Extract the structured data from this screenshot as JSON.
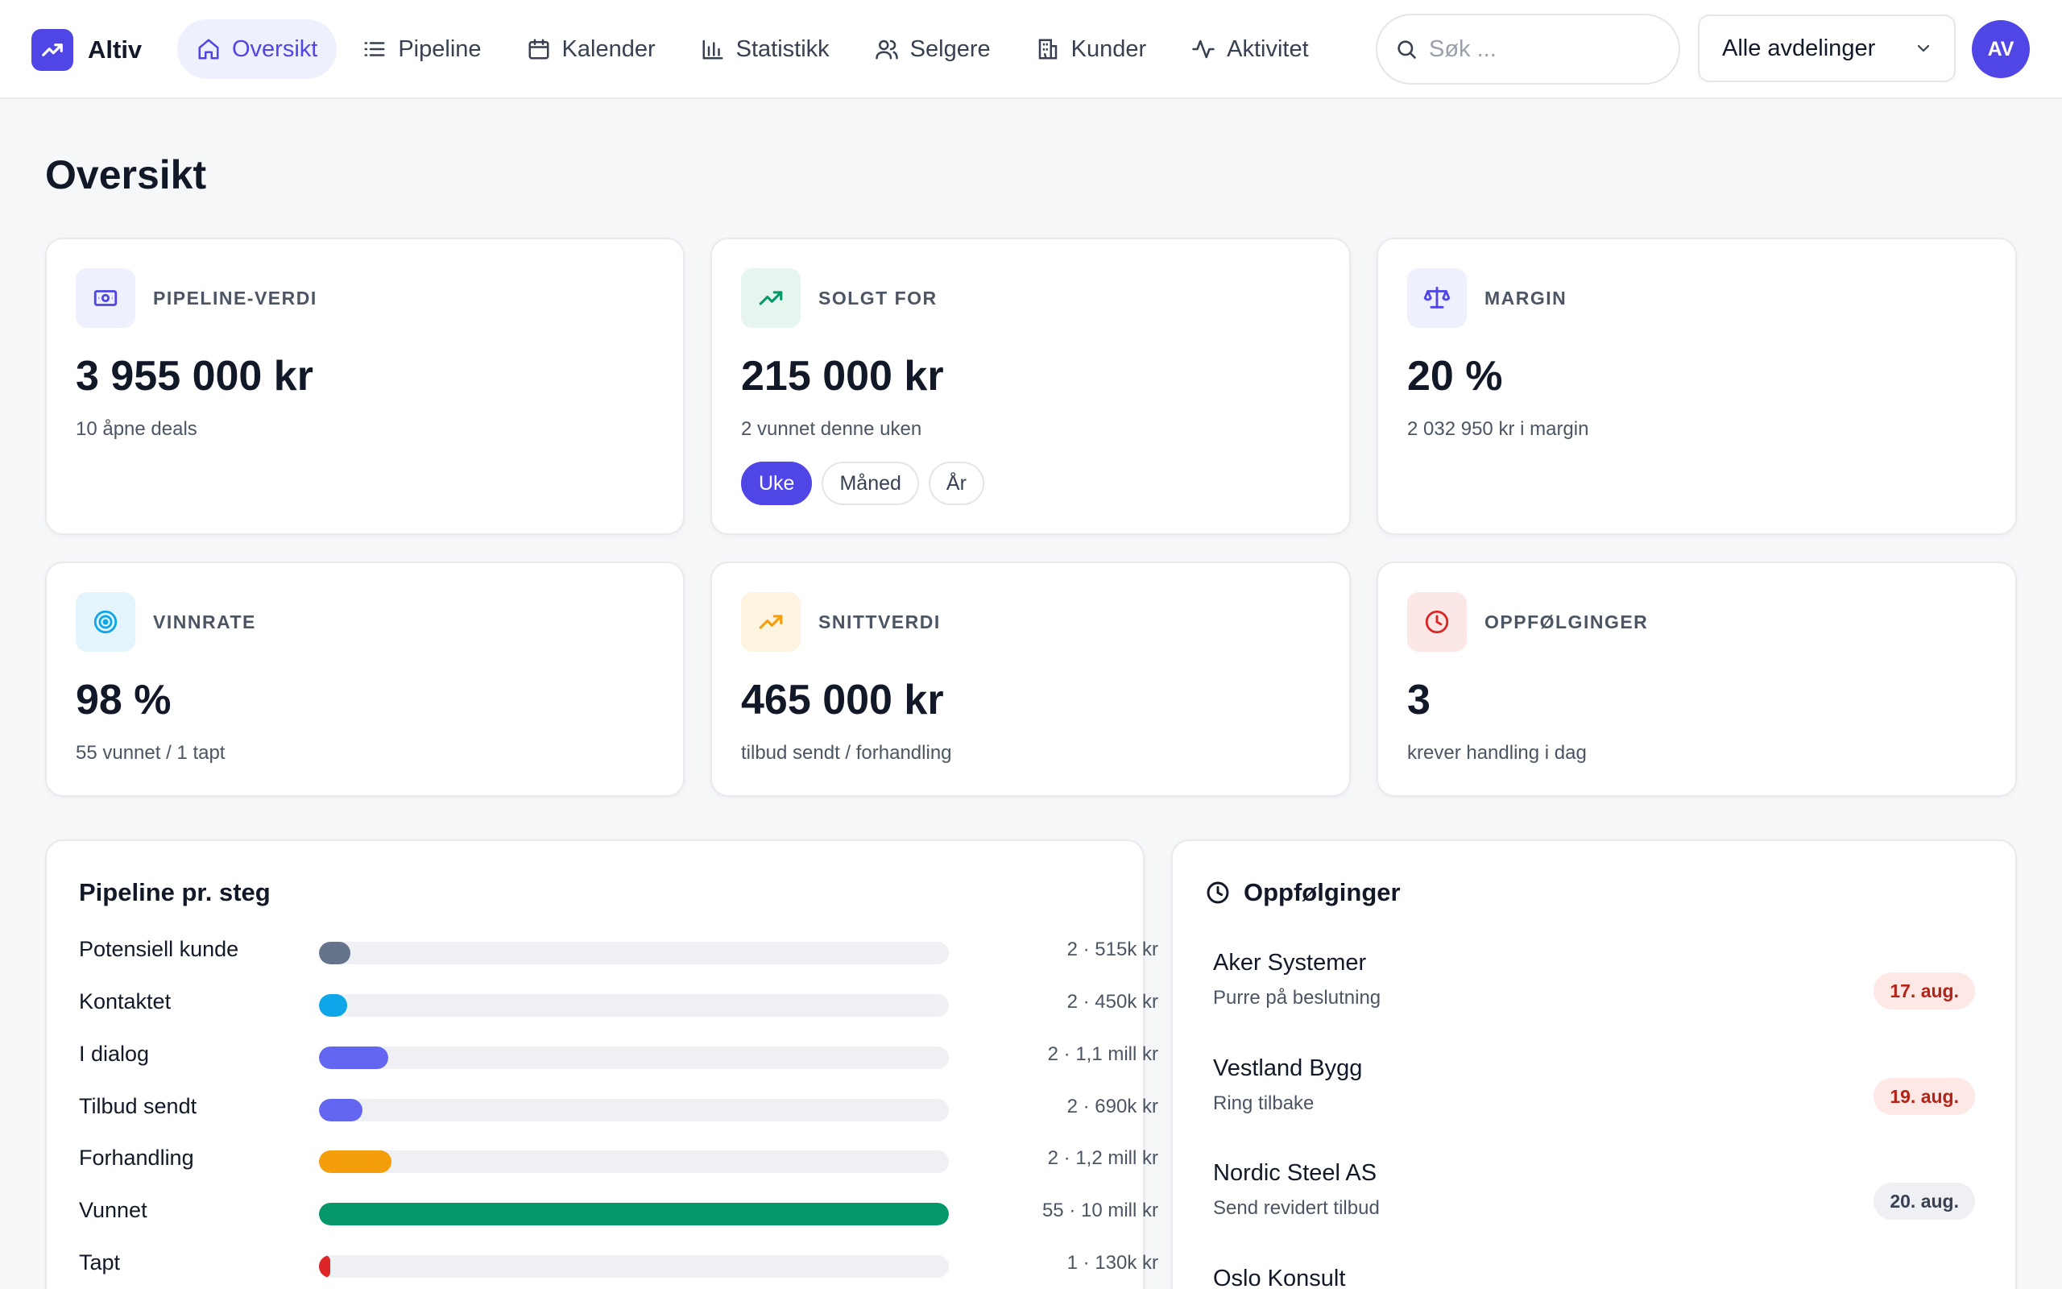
{
  "app": {
    "name": "Altiv"
  },
  "nav": {
    "items": [
      {
        "label": "Oversikt",
        "icon": "home-icon",
        "active": true
      },
      {
        "label": "Pipeline",
        "icon": "list-icon",
        "active": false
      },
      {
        "label": "Kalender",
        "icon": "calendar-icon",
        "active": false
      },
      {
        "label": "Statistikk",
        "icon": "bar-chart-icon",
        "active": false
      },
      {
        "label": "Selgere",
        "icon": "users-icon",
        "active": false
      },
      {
        "label": "Kunder",
        "icon": "building-icon",
        "active": false
      },
      {
        "label": "Aktivitet",
        "icon": "activity-icon",
        "active": false
      }
    ]
  },
  "search": {
    "placeholder": "Søk ...",
    "value": ""
  },
  "department": {
    "selected": "Alle avdelinger"
  },
  "user": {
    "initials": "AV"
  },
  "page": {
    "title": "Oversikt"
  },
  "stats": [
    {
      "label": "PIPELINE-VERDI",
      "value": "3 955 000 kr",
      "sub": "10 åpne deals",
      "icon": "money-icon",
      "accent": "#4f46e5"
    },
    {
      "label": "SOLGT FOR",
      "value": "215 000 kr",
      "sub": "2 vunnet denne uken",
      "icon": "trend-up-icon",
      "accent": "#059669"
    },
    {
      "label": "MARGIN",
      "value": "20 %",
      "sub": "2 032 950 kr i margin",
      "icon": "scale-icon",
      "accent": "#4f46e5"
    },
    {
      "label": "VINNRATE",
      "value": "98 %",
      "sub": "55 vunnet / 1 tapt",
      "icon": "target-icon",
      "accent": "#0ea5e9"
    },
    {
      "label": "SNITTVERDI",
      "value": "465 000 kr",
      "sub": "tilbud sendt / forhandling",
      "icon": "trend-up-icon",
      "accent": "#f59e0b"
    },
    {
      "label": "OPPFØLGINGER",
      "value": "3",
      "sub": "krever handling i dag",
      "icon": "clock-icon",
      "accent": "#dc2626"
    }
  ],
  "period": {
    "options": [
      "Uke",
      "Måned",
      "År"
    ],
    "selected": "Uke"
  },
  "pipeline": {
    "title": "Pipeline pr. steg",
    "stages": [
      {
        "label": "Potensiell kunde",
        "value": "2 · 515k kr",
        "fill": 0.05,
        "color": "#64748b"
      },
      {
        "label": "Kontaktet",
        "value": "2 · 450k kr",
        "fill": 0.045,
        "color": "#0ea5e9"
      },
      {
        "label": "I dialog",
        "value": "2 · 1,1 mill kr",
        "fill": 0.11,
        "color": "#6366f1"
      },
      {
        "label": "Tilbud sendt",
        "value": "2 · 690k kr",
        "fill": 0.069,
        "color": "#6366f1"
      },
      {
        "label": "Forhandling",
        "value": "2 · 1,2 mill kr",
        "fill": 0.115,
        "color": "#f59e0b"
      },
      {
        "label": "Vunnet",
        "value": "55 · 10 mill kr",
        "fill": 1.0,
        "color": "#059669"
      },
      {
        "label": "Tapt",
        "value": "1 · 130k kr",
        "fill": 0.013,
        "color": "#dc2626"
      }
    ]
  },
  "followups": {
    "title": "Oppfølginger",
    "items": [
      {
        "name": "Aker Systemer",
        "desc": "Purre på beslutning",
        "date": "17. aug.",
        "status": "overdue"
      },
      {
        "name": "Vestland Bygg",
        "desc": "Ring tilbake",
        "date": "19. aug.",
        "status": "overdue"
      },
      {
        "name": "Nordic Steel AS",
        "desc": "Send revidert tilbud",
        "date": "20. aug.",
        "status": "upcoming"
      },
      {
        "name": "Oslo Konsult",
        "desc": "",
        "date": "",
        "status": "upcoming"
      }
    ]
  },
  "colors": {
    "brand": "#4f46e5",
    "overdue_bg": "#fde8e6",
    "overdue_text": "#b42318",
    "upcoming_bg": "#eef0f3",
    "upcoming_text": "#374151"
  }
}
